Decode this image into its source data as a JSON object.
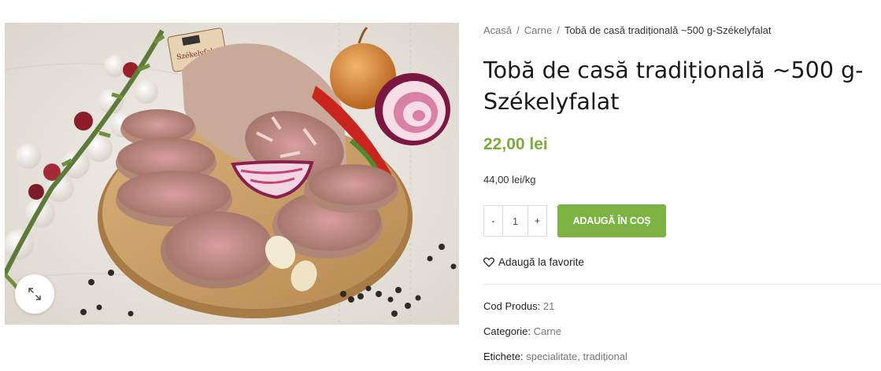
{
  "breadcrumb": {
    "home": "Acasă",
    "category": "Carne",
    "current": "Tobă de casă tradițională ~500 g-Székelyfalat"
  },
  "product": {
    "title": "Tobă de casă tradițională ~500 g-Székelyfalat",
    "price": "22,00 lei",
    "unit_price": "44,00 lei/kg",
    "quantity": "1",
    "qty_minus": "-",
    "qty_plus": "+",
    "add_to_cart": "ADAUGĂ ÎN COȘ",
    "wishlist": "Adaugă la favorite"
  },
  "meta": {
    "sku_label": "Cod Produs:",
    "sku_value": "21",
    "category_label": "Categorie:",
    "category_value": "Carne",
    "tags_label": "Etichete:",
    "tags": [
      "specialitate",
      "tradițional"
    ],
    "tag_separator": ","
  },
  "image": {
    "label_text": "Székelyfalat"
  },
  "colors": {
    "accent": "#7cb342",
    "price": "#7cab3b"
  },
  "icons": {
    "zoom": "expand-icon",
    "wishlist": "heart-icon"
  }
}
